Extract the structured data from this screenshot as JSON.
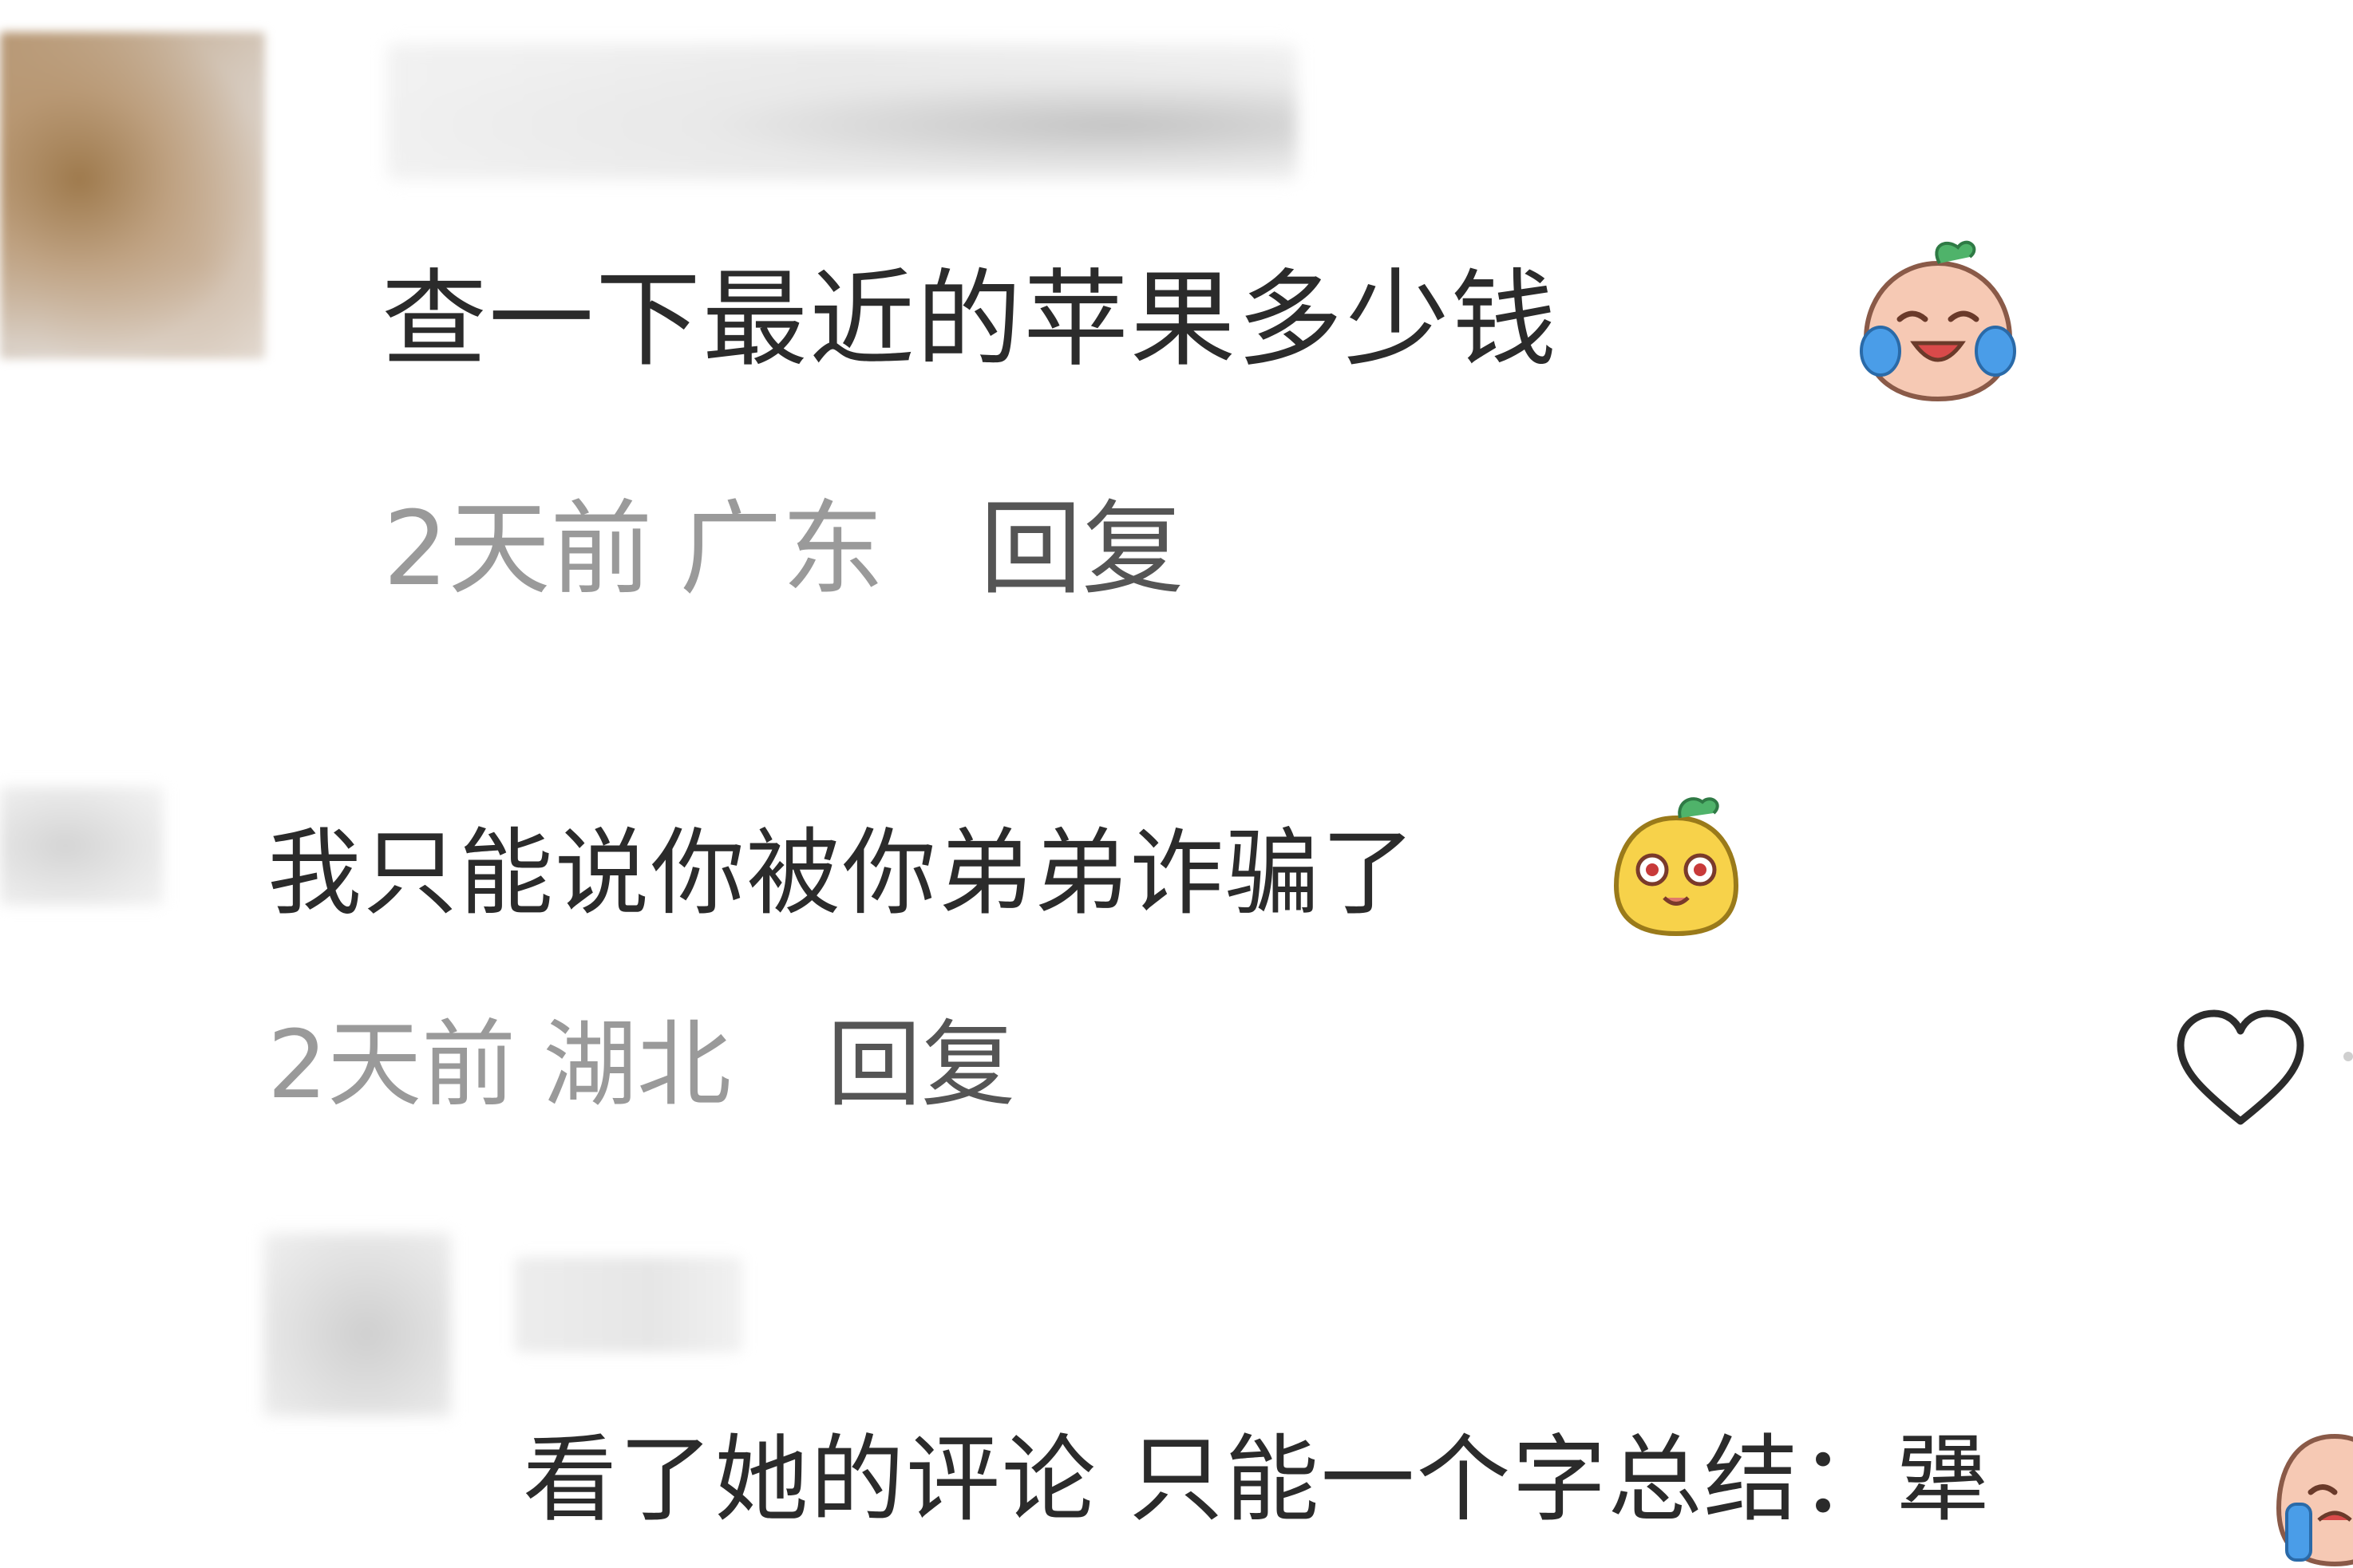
{
  "comments": [
    {
      "text": "查一下最近的苹果多少钱",
      "emoji": "crying-laughing-emoji",
      "time": "2天前",
      "location": "广东",
      "reply_label": "回复"
    },
    {
      "text": "我只能说你被你弟弟诈骗了",
      "emoji": "smug-face-emoji",
      "time": "2天前",
      "location": "湖北",
      "reply_label": "回复"
    },
    {
      "text": "看了她的评论 只能一个字总结：犟",
      "emoji": "crying-emoji"
    }
  ],
  "icons": {
    "like": "heart-outline-icon"
  },
  "colors": {
    "comment_text": "#2b2b2b",
    "meta_text": "#9a9a9a",
    "reply_text": "#555555",
    "background": "#ffffff"
  }
}
